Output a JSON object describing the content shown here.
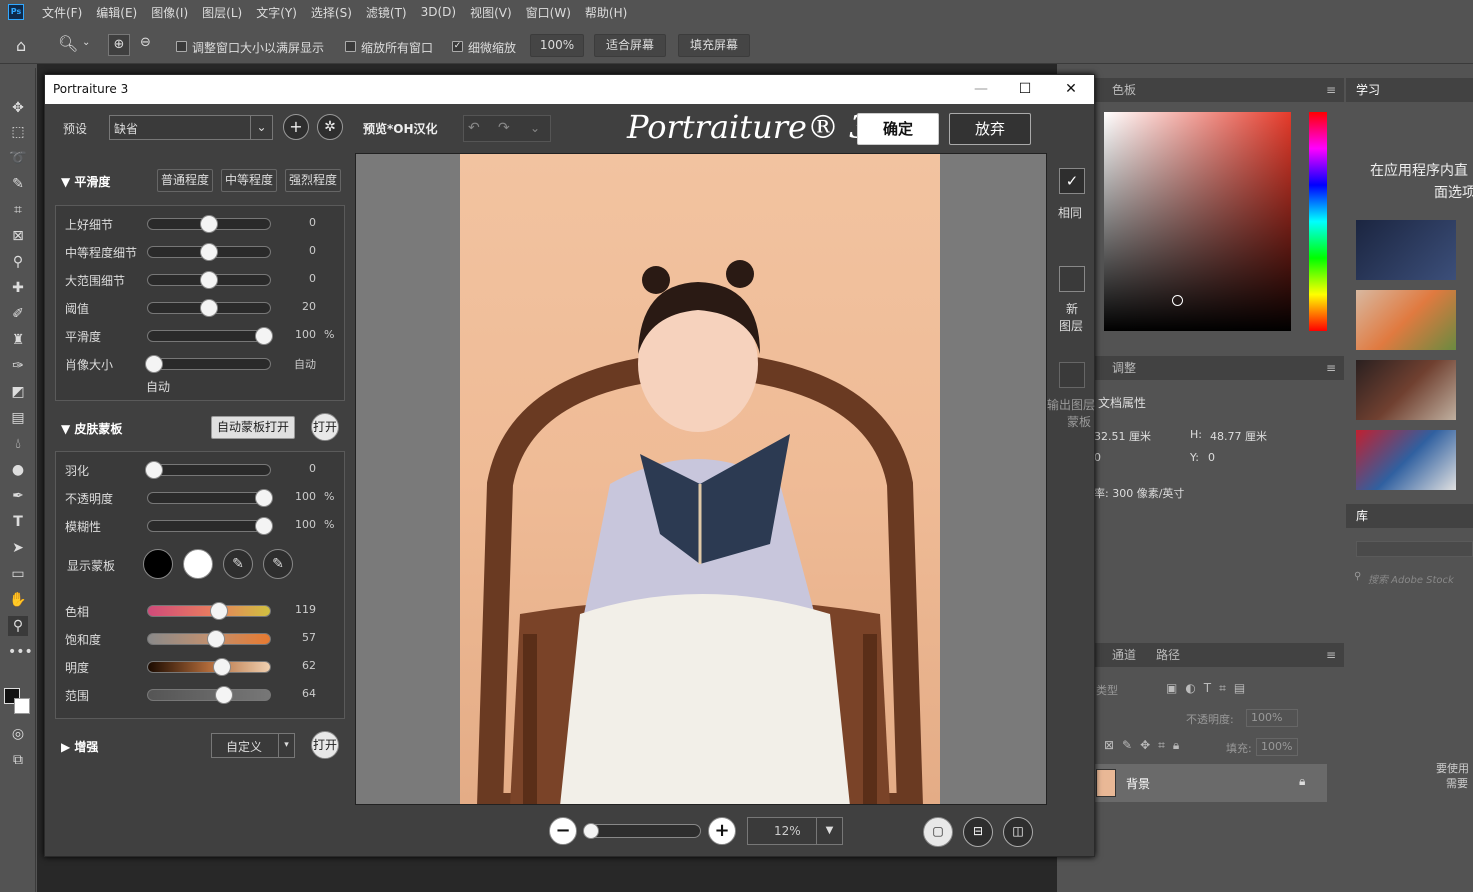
{
  "menubar": {
    "logo": "Ps",
    "items": [
      "文件(F)",
      "编辑(E)",
      "图像(I)",
      "图层(L)",
      "文字(Y)",
      "选择(S)",
      "滤镜(T)",
      "3D(D)",
      "视图(V)",
      "窗口(W)",
      "帮助(H)"
    ]
  },
  "options": {
    "resize_windows_label": "调整窗口大小以满屏显示",
    "resize_windows_checked": false,
    "zoom_all_label": "缩放所有窗口",
    "zoom_all_checked": false,
    "scrubby_zoom_label": "细微缩放",
    "scrubby_zoom_checked": true,
    "zoom_value": "100%",
    "fit_screen": "适合屏幕",
    "fill_screen": "填充屏幕"
  },
  "plugin": {
    "title": "Portraiture 3",
    "preset_label": "预设",
    "preset_value": "缺省",
    "preview_label": "预览*OH汉化",
    "brand": "Portraiture® 3",
    "ok": "确定",
    "cancel": "放弃",
    "info": "i",
    "smoothing": {
      "title": "平滑度",
      "btn_normal": "普通程度",
      "btn_medium": "中等程度",
      "btn_strong": "强烈程度",
      "sliders": [
        {
          "label": "上好细节",
          "value": "0",
          "frac": 0.5,
          "unit": ""
        },
        {
          "label": "中等程度细节",
          "value": "0",
          "frac": 0.5,
          "unit": ""
        },
        {
          "label": "大范围细节",
          "value": "0",
          "frac": 0.5,
          "unit": ""
        },
        {
          "label": "阈值",
          "value": "20",
          "frac": 0.5,
          "unit": ""
        },
        {
          "label": "平滑度",
          "value": "100",
          "frac": 0.95,
          "unit": "%"
        },
        {
          "label": "肖像大小",
          "value": "自动",
          "frac": 0.05,
          "unit": ""
        }
      ],
      "auto_label": "自动"
    },
    "skinmask": {
      "title": "皮肤蒙板",
      "auto_open": "自动蒙板打开",
      "open": "打开",
      "sliders": [
        {
          "label": "羽化",
          "value": "0",
          "frac": 0.05,
          "unit": ""
        },
        {
          "label": "不透明度",
          "value": "100",
          "frac": 0.95,
          "unit": "%"
        },
        {
          "label": "模糊性",
          "value": "100",
          "frac": 0.95,
          "unit": "%"
        }
      ],
      "show_mask_label": "显示蒙板",
      "color_sliders": [
        {
          "label": "色相",
          "value": "119",
          "frac": 0.58
        },
        {
          "label": "饱和度",
          "value": "57",
          "frac": 0.56
        },
        {
          "label": "明度",
          "value": "62",
          "frac": 0.61
        },
        {
          "label": "范围",
          "value": "64",
          "frac": 0.62
        }
      ]
    },
    "enhance": {
      "title": "增强",
      "custom": "自定义",
      "open": "打开"
    },
    "right": {
      "same_label": "相同",
      "new_layer_label1": "新",
      "new_layer_label2": "图层",
      "output_label1": "输出图层",
      "output_label2": "蒙板"
    },
    "zoom": {
      "value": "12%",
      "frac": 0.03
    }
  },
  "panels": {
    "color_tab": "色板",
    "adjust_tab": "调整",
    "doc_props": "文档属性",
    "w_value": "32.51 厘米",
    "h_label": "H:",
    "h_value": "48.77 厘米",
    "x_value": "0",
    "y_label": "Y:",
    "y_value": "0",
    "resolution": "率: 300 像素/英寸",
    "channels_tab": "通道",
    "paths_tab": "路径",
    "type_label": "类型",
    "opacity_label": "不透明度:",
    "opacity_value": "100%",
    "fill_label": "填充:",
    "fill_value": "100%",
    "layer_name": "背景"
  },
  "learn": {
    "tab": "学习",
    "text1": "在应用程序内直",
    "text2": "面选项",
    "library_tab": "库",
    "search_placeholder": "搜索 Adobe Stock",
    "hint1": "要使用",
    "hint2": "需要"
  }
}
